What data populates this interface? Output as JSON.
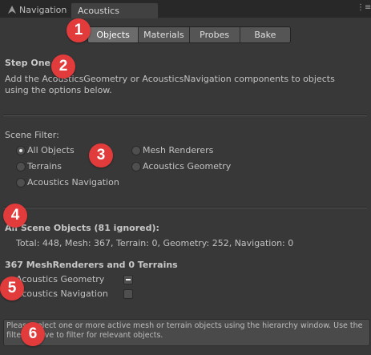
{
  "tabs": {
    "navigation": "Navigation",
    "acoustics": "Acoustics"
  },
  "toolbar": [
    "Objects",
    "Materials",
    "Probes",
    "Bake"
  ],
  "step": {
    "title": "Step One",
    "text": "Add the AcousticsGeometry or AcousticsNavigation components to objects using the options below."
  },
  "scene_filter": {
    "label": "Scene Filter:",
    "options": [
      "All Objects",
      "Mesh Renderers",
      "Terrains",
      "Acoustics Geometry",
      "Acoustics Navigation"
    ],
    "selected": "All Objects"
  },
  "all_scene": {
    "title": "All Scene Objects (81 ignored):",
    "stats": "Total: 448, Mesh: 367, Terrain: 0, Geometry: 252, Navigation: 0"
  },
  "mesh_section": {
    "title": "367 MeshRenderers and 0 Terrains",
    "geometry_label": "Acoustics Geometry",
    "geometry_state": "mixed",
    "navigation_label": "Acoustics Navigation",
    "navigation_state": "unchecked"
  },
  "help": "Please select one or more active mesh or terrain objects using the hierarchy window. Use the filters above to filter for relevant objects.",
  "badges": [
    "1",
    "2",
    "3",
    "4",
    "5",
    "6"
  ],
  "colors": {
    "badge": "#e23b3b",
    "background": "#383838"
  }
}
